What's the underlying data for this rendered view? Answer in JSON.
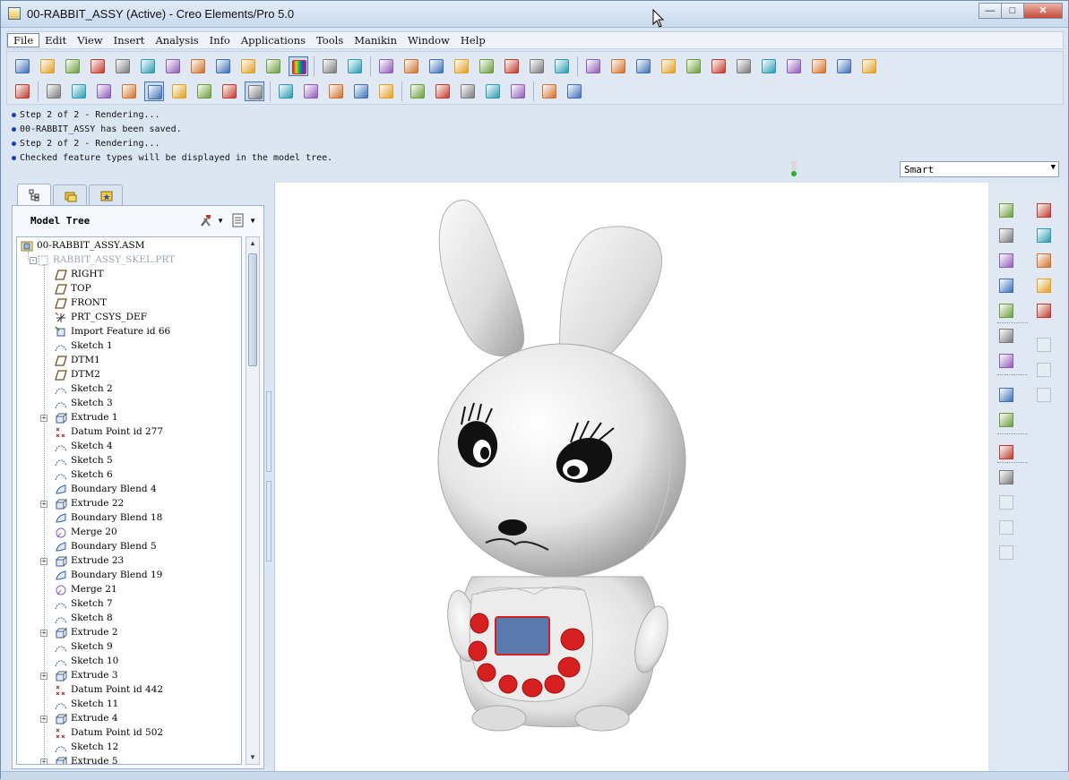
{
  "window": {
    "title": "00-RABBIT_ASSY (Active) - Creo Elements/Pro 5.0",
    "controls": [
      "minimize-icon",
      "maximize-icon",
      "close-icon"
    ]
  },
  "menubar": {
    "items": [
      "File",
      "Edit",
      "View",
      "Insert",
      "Analysis",
      "Info",
      "Applications",
      "Tools",
      "Manikin",
      "Window",
      "Help"
    ],
    "active_index": 0
  },
  "toolbar": {
    "row1": [
      "check-out-icon",
      "print-preview-icon",
      "new-file-icon",
      "open-folder-icon",
      "open-recent-icon",
      "edit-icon",
      "check-icon",
      "close-window-icon",
      "save-icon",
      "save-copy-icon",
      "print-icon",
      "color-icon",
      "undo-icon",
      "redo-icon",
      "cut-icon",
      "copy-icon",
      "paste-icon",
      "paste-special-icon",
      "regenerate-icon",
      "regen-manager-icon",
      "find-icon",
      "select-box-icon",
      "spin-center-icon",
      "orient-icon",
      "shading-icon",
      "pan-icon",
      "layers-icon",
      "saved-views-icon",
      "refit-icon",
      "zoom-in-icon",
      "zoom-out-icon",
      "zoom-fit-icon",
      "repaint-icon",
      "annotation-icon"
    ],
    "row2": [
      "user-icon",
      "hidden-line-icon",
      "no-hidden-icon",
      "wireframe-icon",
      "edges-icon",
      "shaded-edges-icon",
      "shaded-icon",
      "view-front-icon",
      "view-top-icon",
      "view-iso-icon",
      "display-planes-icon",
      "display-axes-icon",
      "display-points-icon",
      "display-csys-icon",
      "display-annotations-icon",
      "render-icon",
      "scene-icon",
      "globe-icon",
      "appearance-icon",
      "model-player-icon",
      "hierarchy-icon",
      "context-help-icon"
    ]
  },
  "messages": [
    "Step 2 of 2 - Rendering...",
    "00-RABBIT_ASSY has been saved.",
    "Step 2 of 2 - Rendering...",
    "Checked feature types will be displayed in the model tree."
  ],
  "filter": {
    "value": "Smart"
  },
  "navigator": {
    "tabs": [
      "model-tree-tab-icon",
      "folder-browser-tab-icon",
      "favorites-tab-icon"
    ],
    "title": "Model Tree"
  },
  "tree": [
    {
      "label": "00-RABBIT_ASSY.ASM",
      "icon": "assembly-icon",
      "level": 0,
      "expander": ""
    },
    {
      "label": "RABBIT_ASSY_SKEL.PRT",
      "icon": "skeleton-part-icon",
      "level": 1,
      "expander": "-",
      "dim": true
    },
    {
      "label": "RIGHT",
      "icon": "datum-plane-icon",
      "level": 2
    },
    {
      "label": "TOP",
      "icon": "datum-plane-icon",
      "level": 2
    },
    {
      "label": "FRONT",
      "icon": "datum-plane-icon",
      "level": 2
    },
    {
      "label": "PRT_CSYS_DEF",
      "icon": "csys-icon",
      "level": 2
    },
    {
      "label": "Import Feature id 66",
      "icon": "import-feature-icon",
      "level": 2
    },
    {
      "label": "Sketch 1",
      "icon": "sketch-icon",
      "level": 2
    },
    {
      "label": "DTM1",
      "icon": "datum-plane-icon",
      "level": 2
    },
    {
      "label": "DTM2",
      "icon": "datum-plane-icon",
      "level": 2
    },
    {
      "label": "Sketch 2",
      "icon": "sketch-icon",
      "level": 2
    },
    {
      "label": "Sketch 3",
      "icon": "sketch-icon",
      "level": 2
    },
    {
      "label": "Extrude 1",
      "icon": "extrude-icon",
      "level": 2,
      "expander": "+"
    },
    {
      "label": "Datum Point id 277",
      "icon": "datum-point-icon",
      "level": 2
    },
    {
      "label": "Sketch 4",
      "icon": "sketch-icon",
      "level": 2
    },
    {
      "label": "Sketch 5",
      "icon": "sketch-icon",
      "level": 2
    },
    {
      "label": "Sketch 6",
      "icon": "sketch-icon",
      "level": 2
    },
    {
      "label": "Boundary Blend 4",
      "icon": "boundary-blend-icon",
      "level": 2
    },
    {
      "label": "Extrude 22",
      "icon": "extrude-icon",
      "level": 2,
      "expander": "+"
    },
    {
      "label": "Boundary Blend 18",
      "icon": "boundary-blend-icon",
      "level": 2
    },
    {
      "label": "Merge 20",
      "icon": "merge-icon",
      "level": 2
    },
    {
      "label": "Boundary Blend 5",
      "icon": "boundary-blend-icon",
      "level": 2
    },
    {
      "label": "Extrude 23",
      "icon": "extrude-icon",
      "level": 2,
      "expander": "+"
    },
    {
      "label": "Boundary Blend 19",
      "icon": "boundary-blend-icon",
      "level": 2
    },
    {
      "label": "Merge 21",
      "icon": "merge-icon",
      "level": 2
    },
    {
      "label": "Sketch 7",
      "icon": "sketch-icon",
      "level": 2
    },
    {
      "label": "Sketch 8",
      "icon": "sketch-icon",
      "level": 2
    },
    {
      "label": "Extrude 2",
      "icon": "extrude-icon",
      "level": 2,
      "expander": "+"
    },
    {
      "label": "Sketch 9",
      "icon": "sketch-icon",
      "level": 2
    },
    {
      "label": "Sketch 10",
      "icon": "sketch-icon",
      "level": 2
    },
    {
      "label": "Extrude 3",
      "icon": "extrude-icon",
      "level": 2,
      "expander": "+"
    },
    {
      "label": "Datum Point id 442",
      "icon": "datum-point-icon",
      "level": 2
    },
    {
      "label": "Sketch 11",
      "icon": "sketch-icon",
      "level": 2
    },
    {
      "label": "Extrude 4",
      "icon": "extrude-icon",
      "level": 2,
      "expander": "+"
    },
    {
      "label": "Datum Point id 502",
      "icon": "datum-point-icon",
      "level": 2
    },
    {
      "label": "Sketch 12",
      "icon": "sketch-icon",
      "level": 2
    },
    {
      "label": "Extrude 5",
      "icon": "extrude-icon",
      "level": 2,
      "expander": "+"
    }
  ],
  "right_toolbar": [
    "datum-point-tool-icon",
    "datum-plane-tool-icon",
    "datum-axis-tool-icon",
    "datum-curve-tool-icon",
    "sketch-tool-icon",
    "csys-tool-icon",
    "analysis-tool-icon",
    "insert-part-icon",
    "create-component-icon",
    "repeat-component-icon",
    "edit-definition-icon",
    "redefine-icon",
    "pattern-icon",
    "hole-icon",
    "round-icon",
    "chamfer-icon",
    "draft-icon",
    "shell-icon",
    "rib-icon",
    "mirror-icon",
    "extend-icon",
    "offset-icon"
  ],
  "viewport": {
    "model": "rabbit-3d-model",
    "colors": {
      "body": "#e9e9e9",
      "buttons": "#d62020",
      "screen": "#5a79ad",
      "eyes": "#111111"
    }
  },
  "colors": {
    "chrome": "#dbe6f2",
    "accent": "#1a3cc8"
  }
}
